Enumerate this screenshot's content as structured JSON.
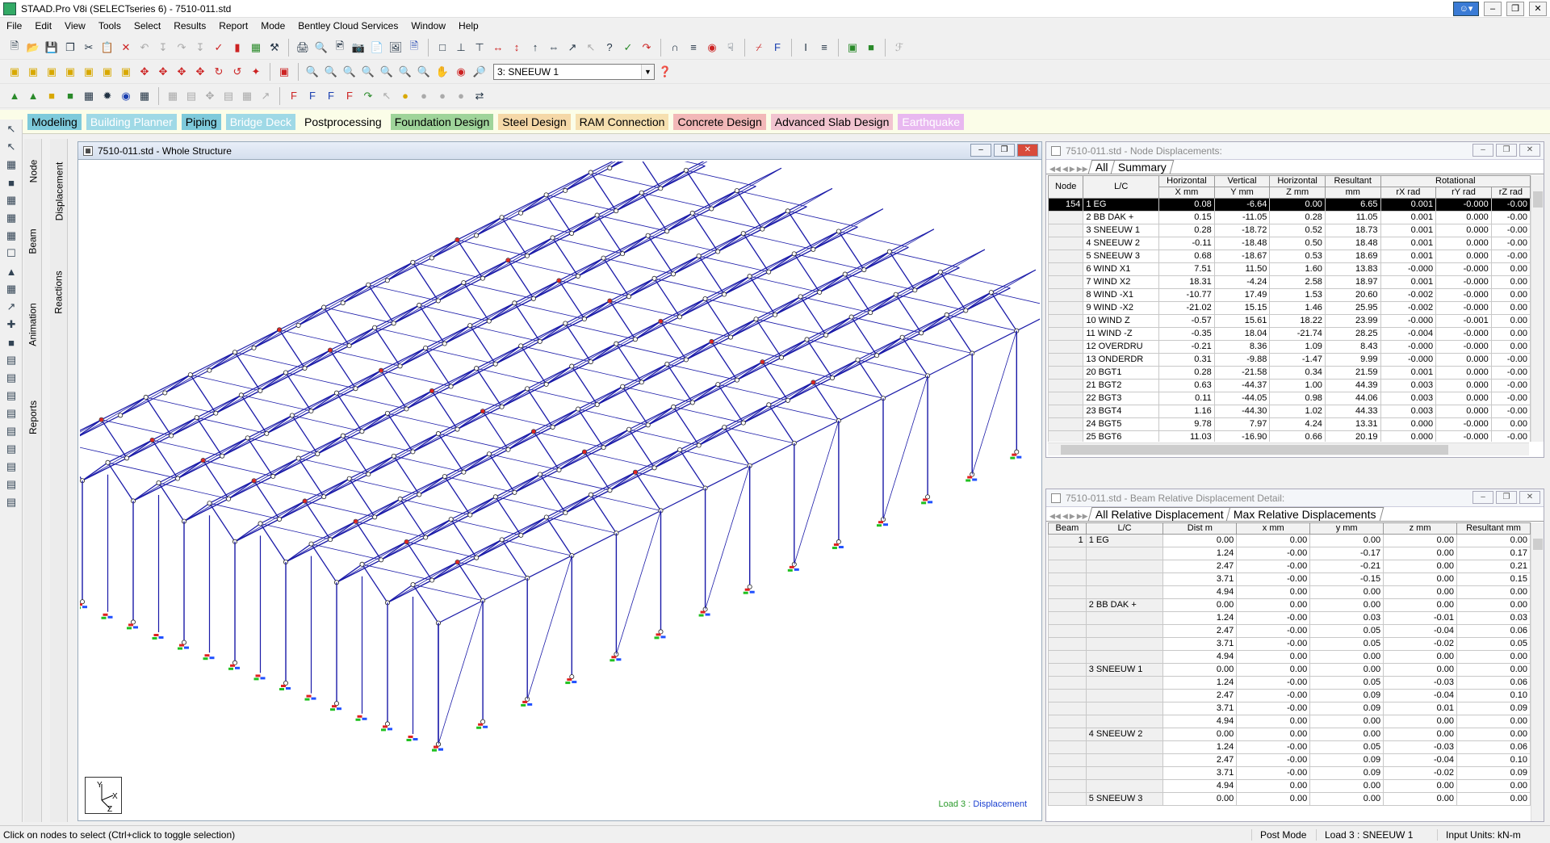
{
  "window": {
    "title": "STAAD.Pro V8i (SELECTseries 6) - 7510-011.std"
  },
  "menu": [
    "File",
    "Edit",
    "View",
    "Tools",
    "Select",
    "Results",
    "Report",
    "Mode",
    "Bentley Cloud Services",
    "Window",
    "Help"
  ],
  "toolbar": {
    "load_case_select": "3: SNEEUW 1"
  },
  "mode_tabs": [
    {
      "label": "Modeling",
      "color": "#7ecadb"
    },
    {
      "label": "Building Planner",
      "color": "#9fd9e6"
    },
    {
      "label": "Piping",
      "color": "#7ecadb"
    },
    {
      "label": "Bridge Deck",
      "color": "#9fd9e6"
    },
    {
      "label": "Postprocessing",
      "color": "#fbfde8"
    },
    {
      "label": "Foundation Design",
      "color": "#9fd49a"
    },
    {
      "label": "Steel Design",
      "color": "#f5d8a8"
    },
    {
      "label": "RAM Connection",
      "color": "#f6e0b0"
    },
    {
      "label": "Concrete Design",
      "color": "#f2b8b8"
    },
    {
      "label": "Advanced Slab Design",
      "color": "#f2c4d0"
    },
    {
      "label": "Earthquake",
      "color": "#e8b8f0"
    }
  ],
  "page_tabs_1": [
    "Node",
    "Beam",
    "Animation",
    "Reports"
  ],
  "page_tabs_2": [
    "Displacement",
    "Reactions"
  ],
  "structure_window": {
    "title": "7510-011.std - Whole Structure",
    "load_label": "Load 3 :",
    "result_label": "Displacement"
  },
  "node_window": {
    "title": "7510-011.std - Node Displacements:",
    "tabs": [
      "All",
      "Summary"
    ],
    "header_groups": [
      "Horizontal",
      "Vertical",
      "Horizontal",
      "Resultant",
      "Rotational"
    ],
    "headers": [
      "Node",
      "L/C",
      "X mm",
      "Y mm",
      "Z mm",
      "mm",
      "rX rad",
      "rY rad",
      "rZ rad"
    ],
    "rows": [
      [
        "154",
        "1 EG",
        "0.08",
        "-6.64",
        "0.00",
        "6.65",
        "0.001",
        "-0.000",
        "-0.00"
      ],
      [
        "",
        "2 BB DAK +",
        "0.15",
        "-11.05",
        "0.28",
        "11.05",
        "0.001",
        "0.000",
        "-0.00"
      ],
      [
        "",
        "3 SNEEUW 1",
        "0.28",
        "-18.72",
        "0.52",
        "18.73",
        "0.001",
        "0.000",
        "-0.00"
      ],
      [
        "",
        "4 SNEEUW 2",
        "-0.11",
        "-18.48",
        "0.50",
        "18.48",
        "0.001",
        "0.000",
        "-0.00"
      ],
      [
        "",
        "5 SNEEUW 3",
        "0.68",
        "-18.67",
        "0.53",
        "18.69",
        "0.001",
        "0.000",
        "-0.00"
      ],
      [
        "",
        "6 WIND X1",
        "7.51",
        "11.50",
        "1.60",
        "13.83",
        "-0.000",
        "-0.000",
        "0.00"
      ],
      [
        "",
        "7 WIND X2",
        "18.31",
        "-4.24",
        "2.58",
        "18.97",
        "0.001",
        "-0.000",
        "0.00"
      ],
      [
        "",
        "8 WIND -X1",
        "-10.77",
        "17.49",
        "1.53",
        "20.60",
        "-0.002",
        "-0.000",
        "0.00"
      ],
      [
        "",
        "9 WIND -X2",
        "-21.02",
        "15.15",
        "1.46",
        "25.95",
        "-0.002",
        "-0.000",
        "0.00"
      ],
      [
        "",
        "10 WIND Z",
        "-0.57",
        "15.61",
        "18.22",
        "23.99",
        "-0.000",
        "-0.001",
        "0.00"
      ],
      [
        "",
        "11 WIND -Z",
        "-0.35",
        "18.04",
        "-21.74",
        "28.25",
        "-0.004",
        "-0.000",
        "0.00"
      ],
      [
        "",
        "12 OVERDRU",
        "-0.21",
        "8.36",
        "1.09",
        "8.43",
        "-0.000",
        "-0.000",
        "0.00"
      ],
      [
        "",
        "13 ONDERDR",
        "0.31",
        "-9.88",
        "-1.47",
        "9.99",
        "-0.000",
        "0.000",
        "-0.00"
      ],
      [
        "",
        "20 BGT1",
        "0.28",
        "-21.58",
        "0.34",
        "21.59",
        "0.001",
        "0.000",
        "-0.00"
      ],
      [
        "",
        "21 BGT2",
        "0.63",
        "-44.37",
        "1.00",
        "44.39",
        "0.003",
        "0.000",
        "-0.00"
      ],
      [
        "",
        "22 BGT3",
        "0.11",
        "-44.05",
        "0.98",
        "44.06",
        "0.003",
        "0.000",
        "-0.00"
      ],
      [
        "",
        "23 BGT4",
        "1.16",
        "-44.30",
        "1.02",
        "44.33",
        "0.003",
        "0.000",
        "-0.00"
      ],
      [
        "",
        "24 BGT5",
        "9.78",
        "7.97",
        "4.24",
        "13.31",
        "0.000",
        "-0.000",
        "0.00"
      ],
      [
        "",
        "25 BGT6",
        "11.03",
        "-16.90",
        "0.66",
        "20.19",
        "0.000",
        "-0.000",
        "-0.00"
      ]
    ]
  },
  "beam_window": {
    "title": "7510-011.std - Beam Relative Displacement Detail:",
    "tabs": [
      "All Relative Displacement",
      "Max Relative Displacements"
    ],
    "headers": [
      "Beam",
      "L/C",
      "Dist m",
      "x mm",
      "y mm",
      "z mm",
      "Resultant mm"
    ],
    "rows": [
      [
        "1",
        "1 EG",
        "0.00",
        "0.00",
        "0.00",
        "0.00",
        "0.00"
      ],
      [
        "",
        "",
        "1.24",
        "-0.00",
        "-0.17",
        "0.00",
        "0.17"
      ],
      [
        "",
        "",
        "2.47",
        "-0.00",
        "-0.21",
        "0.00",
        "0.21"
      ],
      [
        "",
        "",
        "3.71",
        "-0.00",
        "-0.15",
        "0.00",
        "0.15"
      ],
      [
        "",
        "",
        "4.94",
        "0.00",
        "0.00",
        "0.00",
        "0.00"
      ],
      [
        "",
        "2 BB DAK +",
        "0.00",
        "0.00",
        "0.00",
        "0.00",
        "0.00"
      ],
      [
        "",
        "",
        "1.24",
        "-0.00",
        "0.03",
        "-0.01",
        "0.03"
      ],
      [
        "",
        "",
        "2.47",
        "-0.00",
        "0.05",
        "-0.04",
        "0.06"
      ],
      [
        "",
        "",
        "3.71",
        "-0.00",
        "0.05",
        "-0.02",
        "0.05"
      ],
      [
        "",
        "",
        "4.94",
        "0.00",
        "0.00",
        "0.00",
        "0.00"
      ],
      [
        "",
        "3 SNEEUW 1",
        "0.00",
        "0.00",
        "0.00",
        "0.00",
        "0.00"
      ],
      [
        "",
        "",
        "1.24",
        "-0.00",
        "0.05",
        "-0.03",
        "0.06"
      ],
      [
        "",
        "",
        "2.47",
        "-0.00",
        "0.09",
        "-0.04",
        "0.10"
      ],
      [
        "",
        "",
        "3.71",
        "-0.00",
        "0.09",
        "0.01",
        "0.09"
      ],
      [
        "",
        "",
        "4.94",
        "0.00",
        "0.00",
        "0.00",
        "0.00"
      ],
      [
        "",
        "4 SNEEUW 2",
        "0.00",
        "0.00",
        "0.00",
        "0.00",
        "0.00"
      ],
      [
        "",
        "",
        "1.24",
        "-0.00",
        "0.05",
        "-0.03",
        "0.06"
      ],
      [
        "",
        "",
        "2.47",
        "-0.00",
        "0.09",
        "-0.04",
        "0.10"
      ],
      [
        "",
        "",
        "3.71",
        "-0.00",
        "0.09",
        "-0.02",
        "0.09"
      ],
      [
        "",
        "",
        "4.94",
        "0.00",
        "0.00",
        "0.00",
        "0.00"
      ],
      [
        "",
        "5 SNEEUW 3",
        "0.00",
        "0.00",
        "0.00",
        "0.00",
        "0.00"
      ]
    ]
  },
  "status": {
    "message": "Click on nodes to select (Ctrl+click to toggle selection)",
    "mode": "Post Mode",
    "load": "Load 3 : SNEEUW 1",
    "units": "Input Units:  kN-m"
  },
  "colors": {
    "structure": "#1a1aa8",
    "support_red": "#e02020",
    "support_green": "#20c020",
    "support_blue": "#2050ff"
  }
}
